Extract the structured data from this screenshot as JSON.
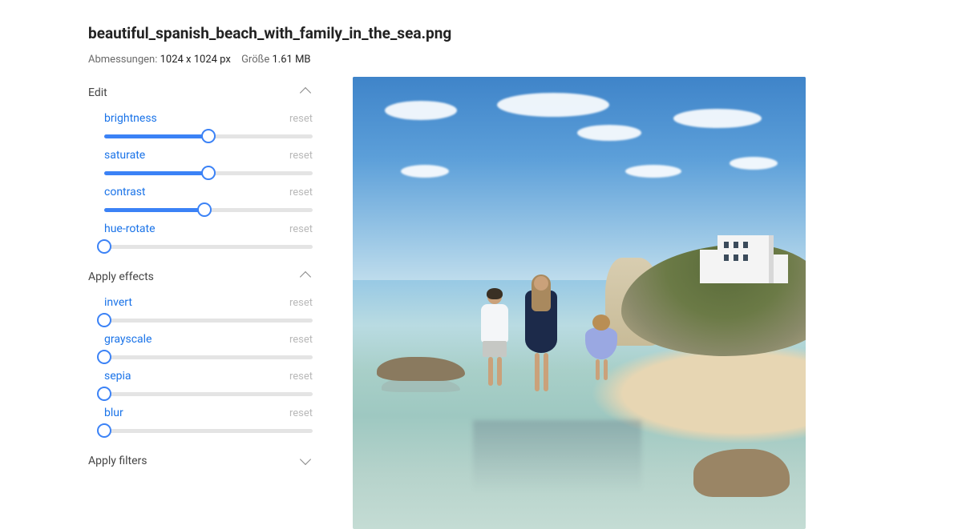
{
  "title": "beautiful_spanish_beach_with_family_in_the_sea.png",
  "meta": {
    "dimensions_label": "Abmessungen:",
    "dimensions_value": "1024 x 1024 px",
    "size_label": "Größe",
    "size_value": "1.61 MB"
  },
  "sections": {
    "edit": {
      "label": "Edit",
      "expanded": true
    },
    "effects": {
      "label": "Apply effects",
      "expanded": true
    },
    "filters": {
      "label": "Apply filters",
      "expanded": false
    }
  },
  "reset_label": "reset",
  "edit_controls": [
    {
      "label": "brightness",
      "value": 50
    },
    {
      "label": "saturate",
      "value": 50
    },
    {
      "label": "contrast",
      "value": 48
    },
    {
      "label": "hue-rotate",
      "value": 0
    }
  ],
  "effect_controls": [
    {
      "label": "invert",
      "value": 0
    },
    {
      "label": "grayscale",
      "value": 0
    },
    {
      "label": "sepia",
      "value": 0
    },
    {
      "label": "blur",
      "value": 0
    }
  ],
  "colors": {
    "accent": "#1a73e8",
    "slider_fill": "#3b82f6"
  }
}
